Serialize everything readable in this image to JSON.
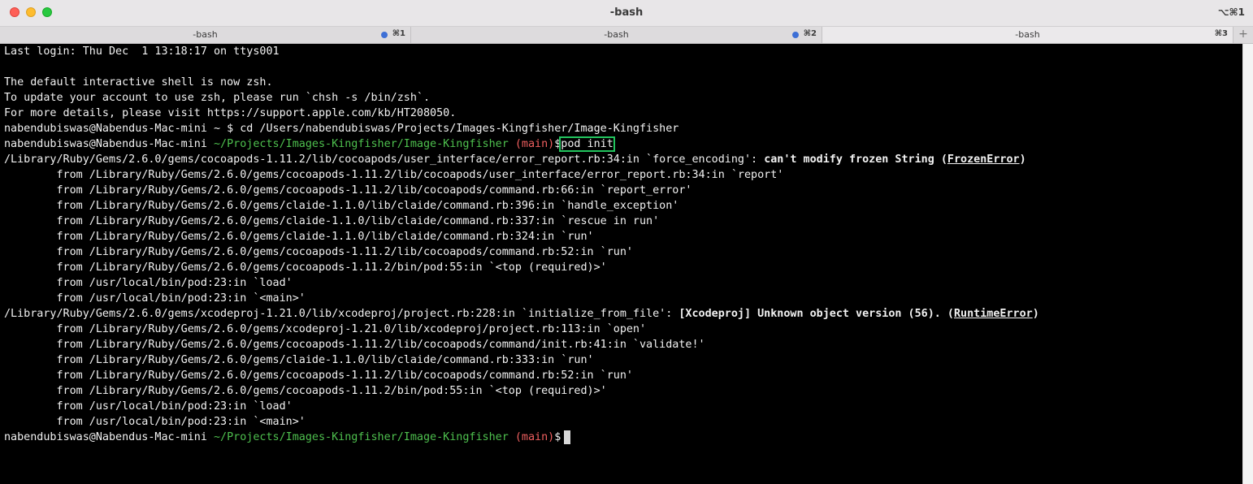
{
  "window": {
    "title": "-bash",
    "shortcut": "⌥⌘1"
  },
  "tabs": [
    {
      "label": "-bash",
      "shortcut": "⌘1"
    },
    {
      "label": "-bash",
      "shortcut": "⌘2"
    },
    {
      "label": "-bash",
      "shortcut": "⌘3"
    }
  ],
  "newtab_label": "+",
  "terminal": {
    "lines": [
      "Last login: Thu Dec  1 13:18:17 on ttys001",
      "",
      "The default interactive shell is now zsh.",
      "To update your account to use zsh, please run `chsh -s /bin/zsh`.",
      "For more details, please visit https://support.apple.com/kb/HT208050.",
      "nabendubiswas@Nabendus-Mac-mini ~ $ cd /Users/nabendubiswas/Projects/Images-Kingfisher/Image-Kingfisher"
    ],
    "prompt1": {
      "user": "nabendubiswas@Nabendus-Mac-mini ",
      "path": "~/Projects/Images-Kingfisher/Image-Kingfisher",
      "branch": " (main)",
      "suffix": "$",
      "command": "pod init"
    },
    "error1": {
      "prefix": "/Library/Ruby/Gems/2.6.0/gems/cocoapods-1.11.2/lib/cocoapods/user_interface/error_report.rb:34:in `force_encoding': ",
      "message": "can't modify frozen String (",
      "class": "FrozenError",
      "close": ")"
    },
    "trace1": [
      "        from /Library/Ruby/Gems/2.6.0/gems/cocoapods-1.11.2/lib/cocoapods/user_interface/error_report.rb:34:in `report'",
      "        from /Library/Ruby/Gems/2.6.0/gems/cocoapods-1.11.2/lib/cocoapods/command.rb:66:in `report_error'",
      "        from /Library/Ruby/Gems/2.6.0/gems/claide-1.1.0/lib/claide/command.rb:396:in `handle_exception'",
      "        from /Library/Ruby/Gems/2.6.0/gems/claide-1.1.0/lib/claide/command.rb:337:in `rescue in run'",
      "        from /Library/Ruby/Gems/2.6.0/gems/claide-1.1.0/lib/claide/command.rb:324:in `run'",
      "        from /Library/Ruby/Gems/2.6.0/gems/cocoapods-1.11.2/lib/cocoapods/command.rb:52:in `run'",
      "        from /Library/Ruby/Gems/2.6.0/gems/cocoapods-1.11.2/bin/pod:55:in `<top (required)>'",
      "        from /usr/local/bin/pod:23:in `load'",
      "        from /usr/local/bin/pod:23:in `<main>'"
    ],
    "error2": {
      "prefix": "/Library/Ruby/Gems/2.6.0/gems/xcodeproj-1.21.0/lib/xcodeproj/project.rb:228:in `initialize_from_file': ",
      "message": "[Xcodeproj] Unknown object version (56). (",
      "class": "RuntimeError",
      "close": ")"
    },
    "trace2": [
      "        from /Library/Ruby/Gems/2.6.0/gems/xcodeproj-1.21.0/lib/xcodeproj/project.rb:113:in `open'",
      "        from /Library/Ruby/Gems/2.6.0/gems/cocoapods-1.11.2/lib/cocoapods/command/init.rb:41:in `validate!'",
      "        from /Library/Ruby/Gems/2.6.0/gems/claide-1.1.0/lib/claide/command.rb:333:in `run'",
      "        from /Library/Ruby/Gems/2.6.0/gems/cocoapods-1.11.2/lib/cocoapods/command.rb:52:in `run'",
      "        from /Library/Ruby/Gems/2.6.0/gems/cocoapods-1.11.2/bin/pod:55:in `<top (required)>'",
      "        from /usr/local/bin/pod:23:in `load'",
      "        from /usr/local/bin/pod:23:in `<main>'"
    ],
    "prompt2": {
      "user": "nabendubiswas@Nabendus-Mac-mini ",
      "path": "~/Projects/Images-Kingfisher/Image-Kingfisher",
      "branch": " (main)",
      "suffix": "$"
    }
  }
}
